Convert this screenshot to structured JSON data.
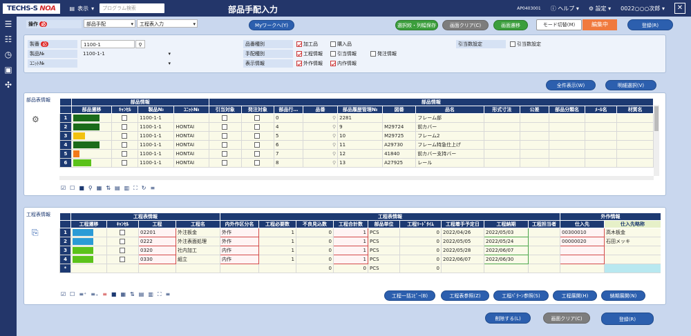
{
  "topbar": {
    "logo_a": "TECHS-S",
    "logo_b": "NOA",
    "view": "表示",
    "search_placeholder": "プログラム検索",
    "title": "部品手配入力",
    "code": "AP0403001",
    "help": "ヘルプ",
    "settings": "設定",
    "user": "0022○○○次郎"
  },
  "toolbar": {
    "op_label": "操作",
    "op_select": "部品手配",
    "screen_select": "工程表入力",
    "mywork": "Myワークへ(Y)",
    "save_sel": "選択絞・列幅保存",
    "clear": "画面クリア(C)",
    "transition": "画面遷移",
    "mode": "モード切替(M)",
    "mode_state": "編集中",
    "register": "登録(R)"
  },
  "form": {
    "seiban_label": "製番",
    "seiban": "1100-1",
    "seihin_label": "製品№",
    "seihin": "1100-1-1",
    "unit_label": "ﾕﾆｯﾄ№",
    "hinshu_label": "品番種別",
    "tehai_label": "手配種別",
    "hyouji_label": "表示情報",
    "hinshu": [
      "加工品",
      "購入品"
    ],
    "tehai": [
      "工程情報",
      "引当情報",
      "発注情報"
    ],
    "hyouji": [
      "外作情報",
      "内作情報"
    ],
    "hikiate_label": "引当数設定",
    "hikiate_chk": "引当数設定"
  },
  "buttons": {
    "show_all": "全件表示(W)",
    "detail_sel": "明細選択(V)",
    "kotei_copy": "工程一括ｺﾋﾟｰ(B)",
    "kotei_ref": "工程表参照(Z)",
    "pattern_ref": "工程ﾊﾟﾀｰﾝ参照(S)",
    "kotei_expand": "工程展開(H)",
    "nouki_expand": "納期展開(N)",
    "delete": "削除する(L)",
    "clear2": "画面クリア(C)",
    "register2": "登録(R)"
  },
  "parts": {
    "tab": "部品表情報",
    "group1": "部品情報",
    "group2": "部品情報",
    "headers": [
      "部品遷移",
      "ｷｬﾝｾﾙ",
      "製品№",
      "ﾕﾆｯﾄ№",
      "引当対象",
      "発注対象",
      "部品行…",
      "品番",
      "部品履歴管理№",
      "図番",
      "品名",
      "形式寸法",
      "公差",
      "部品分類名",
      "ﾒｰﾙ名",
      "材質名"
    ],
    "rows": [
      {
        "n": "1",
        "color": "#1a6b1a",
        "w": "100",
        "seihin": "1100-1-1",
        "unit": "",
        "gyo": "0",
        "hinban": "2281",
        "zuban": "",
        "hinmei": "フレーム部"
      },
      {
        "n": "2",
        "color": "#1a6b1a",
        "w": "100",
        "seihin": "1100-1-1",
        "unit": "HONTAI",
        "gyo": "4",
        "hinban": "9",
        "zuban": "M29724",
        "hinmei": "前カバー"
      },
      {
        "n": "3",
        "color": "#f2c10f",
        "w": "45",
        "seihin": "1100-1-1",
        "unit": "HONTAI",
        "gyo": "5",
        "hinban": "10",
        "zuban": "M29725",
        "hinmei": "フレーム2"
      },
      {
        "n": "4",
        "color": "#1a6b1a",
        "w": "100",
        "seihin": "1100-1-1",
        "unit": "HONTAI",
        "gyo": "6",
        "hinban": "11",
        "zuban": "A29730",
        "hinmei": "フレーム特急仕上げ"
      },
      {
        "n": "5",
        "color": "#f27a1a",
        "w": "25",
        "seihin": "1100-1-1",
        "unit": "HONTAI",
        "gyo": "7",
        "hinban": "12",
        "zuban": "41840",
        "hinmei": "前カバー支持バー"
      },
      {
        "n": "6",
        "color": "#5bc21a",
        "w": "70",
        "seihin": "1100-1-1",
        "unit": "HONTAI",
        "gyo": "8",
        "hinban": "13",
        "zuban": "A27925",
        "hinmei": "レール"
      }
    ]
  },
  "process": {
    "tab": "工程表情報",
    "group1": "工程表情報",
    "group2": "工程表情報",
    "group3": "外作情報",
    "headers": [
      "工程遷移",
      "ｷｬﾝｾﾙ",
      "工程",
      "工程名",
      "内外作区分名",
      "工程必要数",
      "不良見込数",
      "工程合計数",
      "部品単位",
      "工程ﾘｰﾄﾞﾀｲﾑ",
      "工程着手予定日",
      "工程納期",
      "工程担当者",
      "仕入先",
      "仕入先略称"
    ],
    "rows": [
      {
        "n": "1",
        "color": "#2b9bd6",
        "kotei": "02201",
        "name": "外注板金",
        "kubun": "外作",
        "need": "1",
        "furyo": "0",
        "total": "1",
        "tani": "PCS",
        "lead": "0",
        "start": "2022/04/26",
        "nouki": "2022/05/03",
        "shiire": "00300010",
        "ryaku": "高木板金"
      },
      {
        "n": "2",
        "color": "#2b9bd6",
        "kotei": "0222",
        "name": "外注表面処理",
        "kubun": "外作",
        "need": "1",
        "furyo": "0",
        "total": "1",
        "tani": "PCS",
        "lead": "0",
        "start": "2022/05/05",
        "nouki": "2022/05/24",
        "shiire": "00000020",
        "ryaku": "石田メッキ"
      },
      {
        "n": "3",
        "color": "#5bc21a",
        "kotei": "0320",
        "name": "社内加工",
        "kubun": "内作",
        "need": "1",
        "furyo": "0",
        "total": "1",
        "tani": "PCS",
        "lead": "0",
        "start": "2022/05/28",
        "nouki": "2022/06/07",
        "shiire": "",
        "ryaku": ""
      },
      {
        "n": "4",
        "color": "#5bc21a",
        "kotei": "0330",
        "name": "組立",
        "kubun": "内作",
        "need": "1",
        "furyo": "0",
        "total": "1",
        "tani": "PCS",
        "lead": "0",
        "start": "2022/06/07",
        "nouki": "2022/06/30",
        "shiire": "",
        "ryaku": ""
      }
    ],
    "new_row_marker": "*",
    "new_tani": "PCS",
    "new_lead": "0",
    "new_furyo": "0",
    "new_total": "0"
  }
}
